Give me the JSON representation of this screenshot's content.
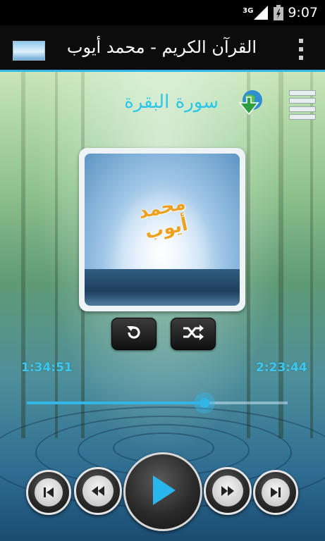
{
  "status_bar": {
    "network": "3G",
    "time": "9:07"
  },
  "action_bar": {
    "title": "القرآن الكريم - محمد أيوب"
  },
  "player": {
    "surah_name": "سورة البقرة",
    "reciter_label": "محمد أيوب",
    "elapsed_time": "1:34:51",
    "total_time": "2:23:44",
    "progress": 0.68
  },
  "colors": {
    "accent": "#33b5e5",
    "title_text": "#2cc6e8",
    "reciter_text": "#f0a020"
  },
  "icons": {
    "overflow": "overflow-menu-icon",
    "globe": "globe-download-icon",
    "list": "playlist-menu-icon",
    "repeat": "repeat-icon",
    "shuffle": "shuffle-icon",
    "previous": "skip-previous-icon",
    "rewind": "rewind-icon",
    "play": "play-icon",
    "forward": "fast-forward-icon",
    "next": "skip-next-icon"
  }
}
